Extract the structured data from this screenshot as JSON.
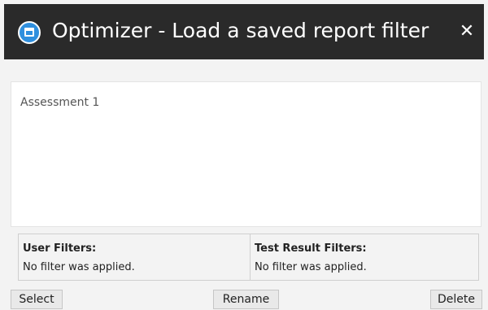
{
  "window": {
    "title": "Optimizer - Load a saved report filter",
    "app_icon": "app-window-icon",
    "close_glyph": "✕",
    "colors": {
      "titlebar": "#2a2a2a",
      "app_icon": "#2f8fde",
      "dialog_background": "#f3f3f3"
    }
  },
  "filter_list": {
    "items": [
      "Assessment 1"
    ]
  },
  "filters": {
    "user": {
      "heading": "User Filters:",
      "value": "No filter was applied."
    },
    "test_result": {
      "heading": "Test Result Filters:",
      "value": "No filter was applied."
    }
  },
  "buttons": {
    "select": "Select",
    "rename": "Rename",
    "delete": "Delete"
  }
}
